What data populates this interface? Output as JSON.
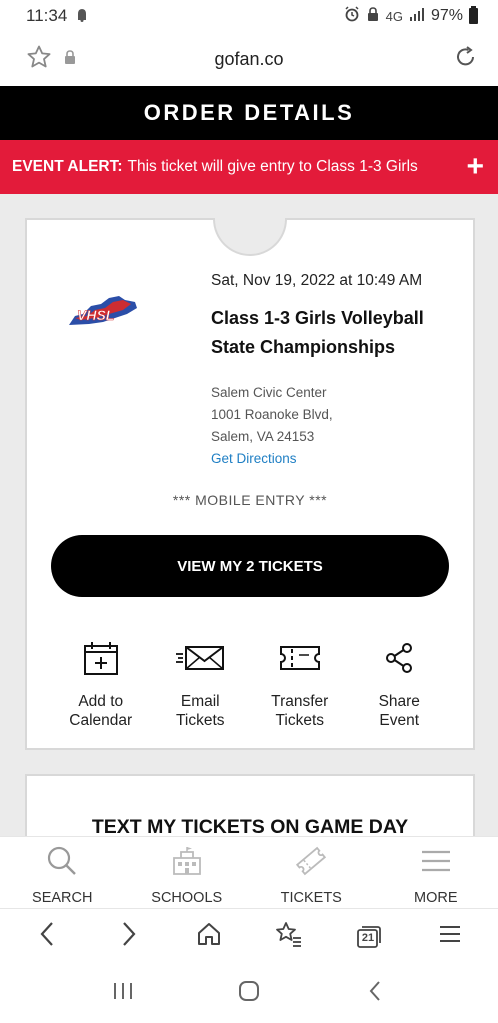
{
  "status_bar": {
    "time": "11:34",
    "battery": "97%",
    "network": "4G"
  },
  "browser": {
    "url": "gofan.co"
  },
  "page": {
    "header_title": "ORDER DETAILS",
    "alert_label": "EVENT ALERT:",
    "alert_text": "This ticket will give entry to Class 1-3 Girls"
  },
  "event": {
    "logo_text": "VHSL",
    "date": "Sat, Nov 19, 2022 at 10:49 AM",
    "title_line1": "Class 1-3 Girls Volleyball",
    "title_line2": "State Championships",
    "venue_name": "Salem Civic Center",
    "address_line1": "1001 Roanoke Blvd,",
    "address_line2": "Salem, VA 24153",
    "directions_link": "Get Directions",
    "entry_type": "*** MOBILE ENTRY ***",
    "view_button": "VIEW MY 2 TICKETS"
  },
  "actions": [
    {
      "line1": "Add to",
      "line2": "Calendar",
      "icon": "calendar-add-icon"
    },
    {
      "line1": "Email",
      "line2": "Tickets",
      "icon": "envelope-icon"
    },
    {
      "line1": "Transfer",
      "line2": "Tickets",
      "icon": "ticket-icon"
    },
    {
      "line1": "Share",
      "line2": "Event",
      "icon": "share-icon"
    }
  ],
  "text_tickets_title": "TEXT MY TICKETS ON GAME DAY",
  "app_nav": [
    {
      "label": "SEARCH",
      "icon": "search-icon"
    },
    {
      "label": "SCHOOLS",
      "icon": "school-icon"
    },
    {
      "label": "TICKETS",
      "icon": "ticket-icon"
    },
    {
      "label": "MORE",
      "icon": "menu-icon"
    }
  ],
  "browser_nav": {
    "tab_count": "21"
  },
  "colors": {
    "alert_red": "#e31b3a",
    "link_blue": "#1f7fc4",
    "logo_red": "#d62b2b",
    "logo_blue": "#2b4ea8"
  }
}
